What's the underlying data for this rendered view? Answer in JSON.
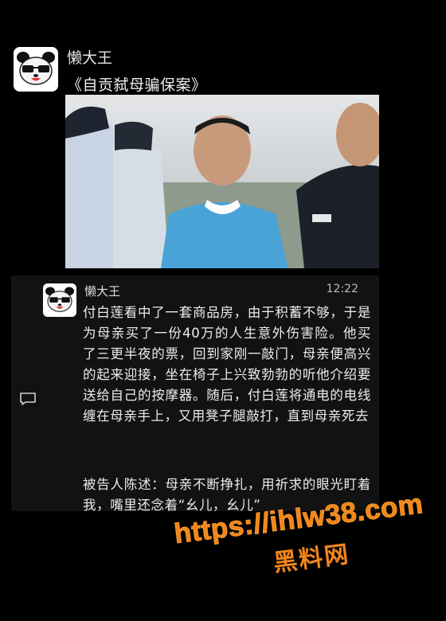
{
  "post": {
    "author": "懒大王",
    "title": "《自贡弑母骗保案》"
  },
  "video": {
    "description_icon": "video-still"
  },
  "card": {
    "author": "懒大王",
    "time": "12:22",
    "paragraph1": "付白莲看中了一套商品房，由于积蓄不够，于是为母亲买了一份40万的人生意外伤害险。他买了三更半夜的票，回到家刚一敲门，母亲便高兴的起来迎接，坐在椅子上兴致勃勃的听他介绍要送给自己的按摩器。随后，付白莲将通电的电线缠在母亲手上，又用凳子腿敲打，直到母亲死去",
    "paragraph2": "被告人陈述：母亲不断挣扎，用祈求的眼光盯着我，嘴里还念着“幺儿，幺儿”"
  },
  "watermark": {
    "url": "https://ihlw38.com",
    "site": "黑料网",
    "color": "#f2851c"
  },
  "icons": {
    "comment": "comment-icon",
    "avatar": "panda-sunglasses-avatar"
  }
}
